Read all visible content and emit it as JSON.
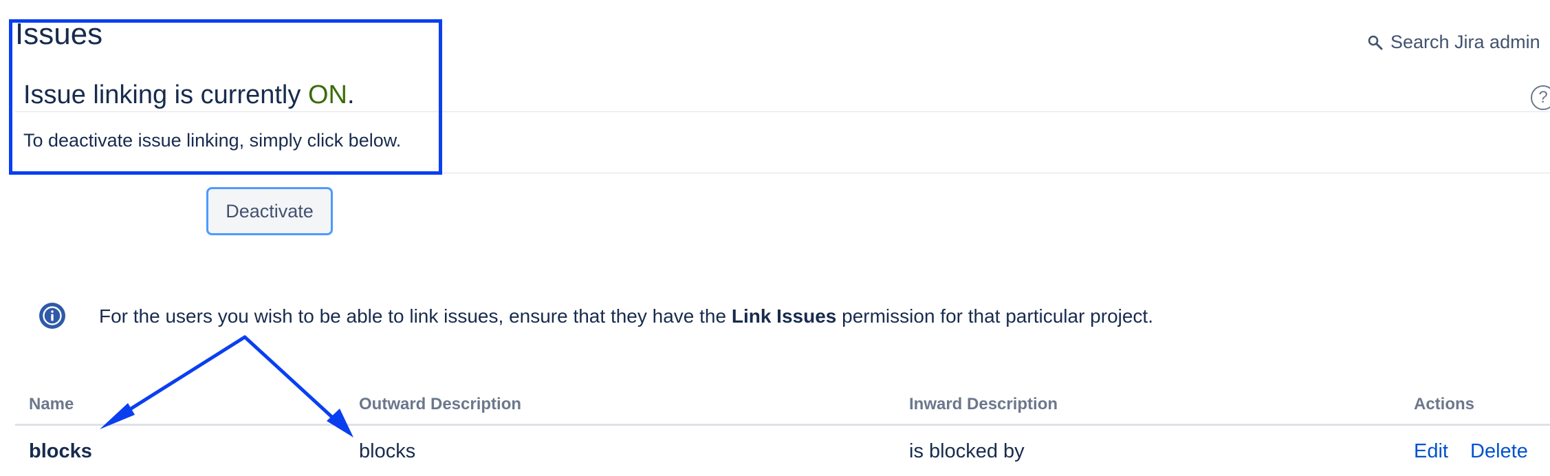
{
  "header": {
    "title": "Issues",
    "search_label": "Search Jira admin"
  },
  "status": {
    "heading_prefix": "Issue linking is currently ",
    "heading_state": "ON",
    "heading_suffix": ".",
    "description": "To deactivate issue linking, simply click below.",
    "deactivate_label": "Deactivate"
  },
  "info": {
    "text_before": "For the users you wish to be able to link issues, ensure that they have the ",
    "text_bold": "Link Issues",
    "text_after": " permission for that particular project."
  },
  "table": {
    "columns": [
      "Name",
      "Outward Description",
      "Inward Description",
      "Actions"
    ],
    "rows": [
      {
        "name": "blocks",
        "outward": "blocks",
        "inward": "is blocked by",
        "actions": [
          "Edit",
          "Delete"
        ]
      }
    ]
  },
  "icons": {
    "search": "magnifier-icon",
    "help": "question-circle-icon",
    "info": "info-circle-icon"
  },
  "colors": {
    "accent_on": "#3a6d0a",
    "link": "#0052cc",
    "annotation": "#0a3ff0",
    "info_icon": "#2e5aa8"
  }
}
